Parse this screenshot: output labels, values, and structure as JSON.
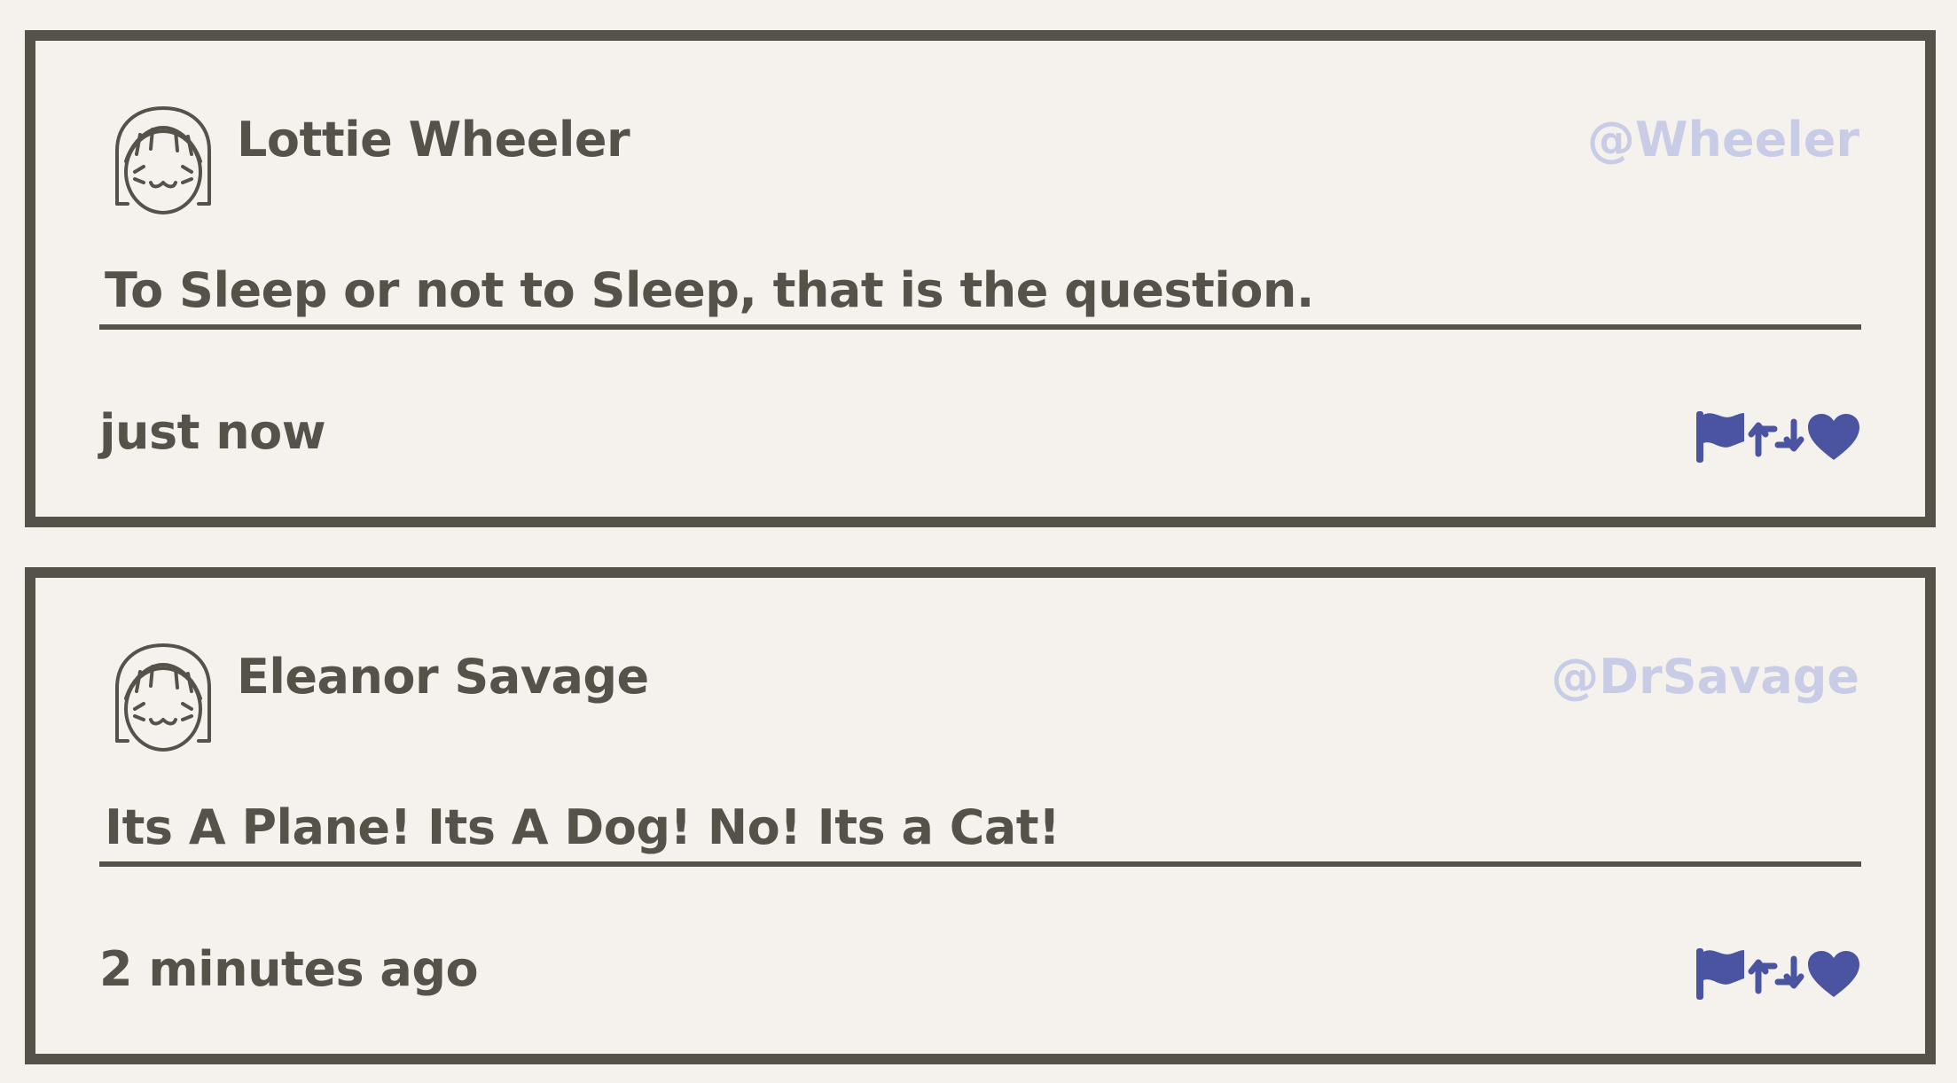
{
  "colors": {
    "background": "#f5f2ed",
    "text": "#55524a",
    "handle": "#c9cce6",
    "icon": "#4a54a0"
  },
  "tweets": [
    {
      "name": "Lottie Wheeler",
      "handle": "@Wheeler",
      "message": "To Sleep or not to Sleep, that is the question.",
      "time": "just now",
      "avatar_icon": "girl-face-icon"
    },
    {
      "name": "Eleanor Savage",
      "handle": "@DrSavage",
      "message": "Its A Plane! Its A Dog! No! Its a Cat!",
      "time": "2 minutes ago",
      "avatar_icon": "girl-face-icon"
    }
  ],
  "action_icons": [
    "flag-icon",
    "retweet-icon",
    "heart-icon"
  ]
}
